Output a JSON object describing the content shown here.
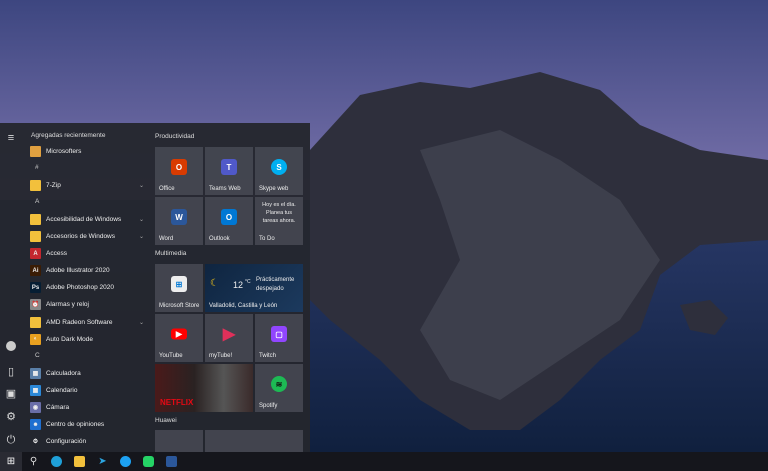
{
  "rail": {
    "icons": [
      "hamburger-menu-icon",
      "user-avatar-icon",
      "documents-icon",
      "pictures-icon",
      "settings-icon",
      "power-icon"
    ]
  },
  "list": {
    "header": "Agregadas recientemente",
    "items": [
      {
        "type": "app",
        "label": "Microsofters",
        "color": "#e0a040"
      },
      {
        "type": "letter",
        "label": "#"
      },
      {
        "type": "folder",
        "label": "7-Zip",
        "expand": true
      },
      {
        "type": "letter",
        "label": "A"
      },
      {
        "type": "folder",
        "label": "Accesibilidad de Windows",
        "expand": true
      },
      {
        "type": "folder",
        "label": "Accesorios de Windows",
        "expand": true
      },
      {
        "type": "app",
        "label": "Access",
        "color": "#c4262e",
        "glyph": "A"
      },
      {
        "type": "app",
        "label": "Adobe Illustrator 2020",
        "color": "#3a1c04",
        "glyph": "Ai"
      },
      {
        "type": "app",
        "label": "Adobe Photoshop 2020",
        "color": "#061e33",
        "glyph": "Ps"
      },
      {
        "type": "app",
        "label": "Alarmas y reloj",
        "color": "#888",
        "glyph": "⏰"
      },
      {
        "type": "folder",
        "label": "AMD Radeon Software",
        "expand": true
      },
      {
        "type": "app",
        "label": "Auto Dark Mode",
        "color": "#e8a020",
        "glyph": "◐"
      },
      {
        "type": "letter",
        "label": "C"
      },
      {
        "type": "app",
        "label": "Calculadora",
        "color": "#5a7fa8",
        "glyph": "▦"
      },
      {
        "type": "app",
        "label": "Calendario",
        "color": "#2b88d8",
        "glyph": "▦"
      },
      {
        "type": "app",
        "label": "Cámara",
        "color": "#6a6ea8",
        "glyph": "◉"
      },
      {
        "type": "app",
        "label": "Centro de opiniones",
        "color": "#1f6fd0",
        "glyph": "☻"
      },
      {
        "type": "app",
        "label": "Configuración",
        "color": "transparent",
        "glyph": "⚙"
      }
    ]
  },
  "groups": [
    {
      "label": "Productividad"
    },
    {
      "label": "Multimedia"
    },
    {
      "label": "Huawei"
    }
  ],
  "tiles": {
    "office": "Office",
    "teams": "Teams Web",
    "skype": "Skype web",
    "word": "Word",
    "outlook": "Outlook",
    "todo": "To Do",
    "todo_msg": "Hoy es el día. Planea tus tareas ahora.",
    "store": "Microsoft Store",
    "weather": {
      "temp": "12",
      "unit": "°C",
      "cond": "Prácticamente despejado",
      "place": "Valladolid, Castilla y León"
    },
    "youtube": "YouTube",
    "mytube": "myTube!",
    "twitch": "Twitch",
    "netflix": "NETFLIX",
    "spotify": "Spotify"
  },
  "taskbar": {
    "icons": [
      "windows-start-icon",
      "search-icon",
      "edge-icon",
      "file-explorer-icon",
      "telegram-icon",
      "twitter-icon",
      "whatsapp-icon",
      "word-icon"
    ]
  }
}
